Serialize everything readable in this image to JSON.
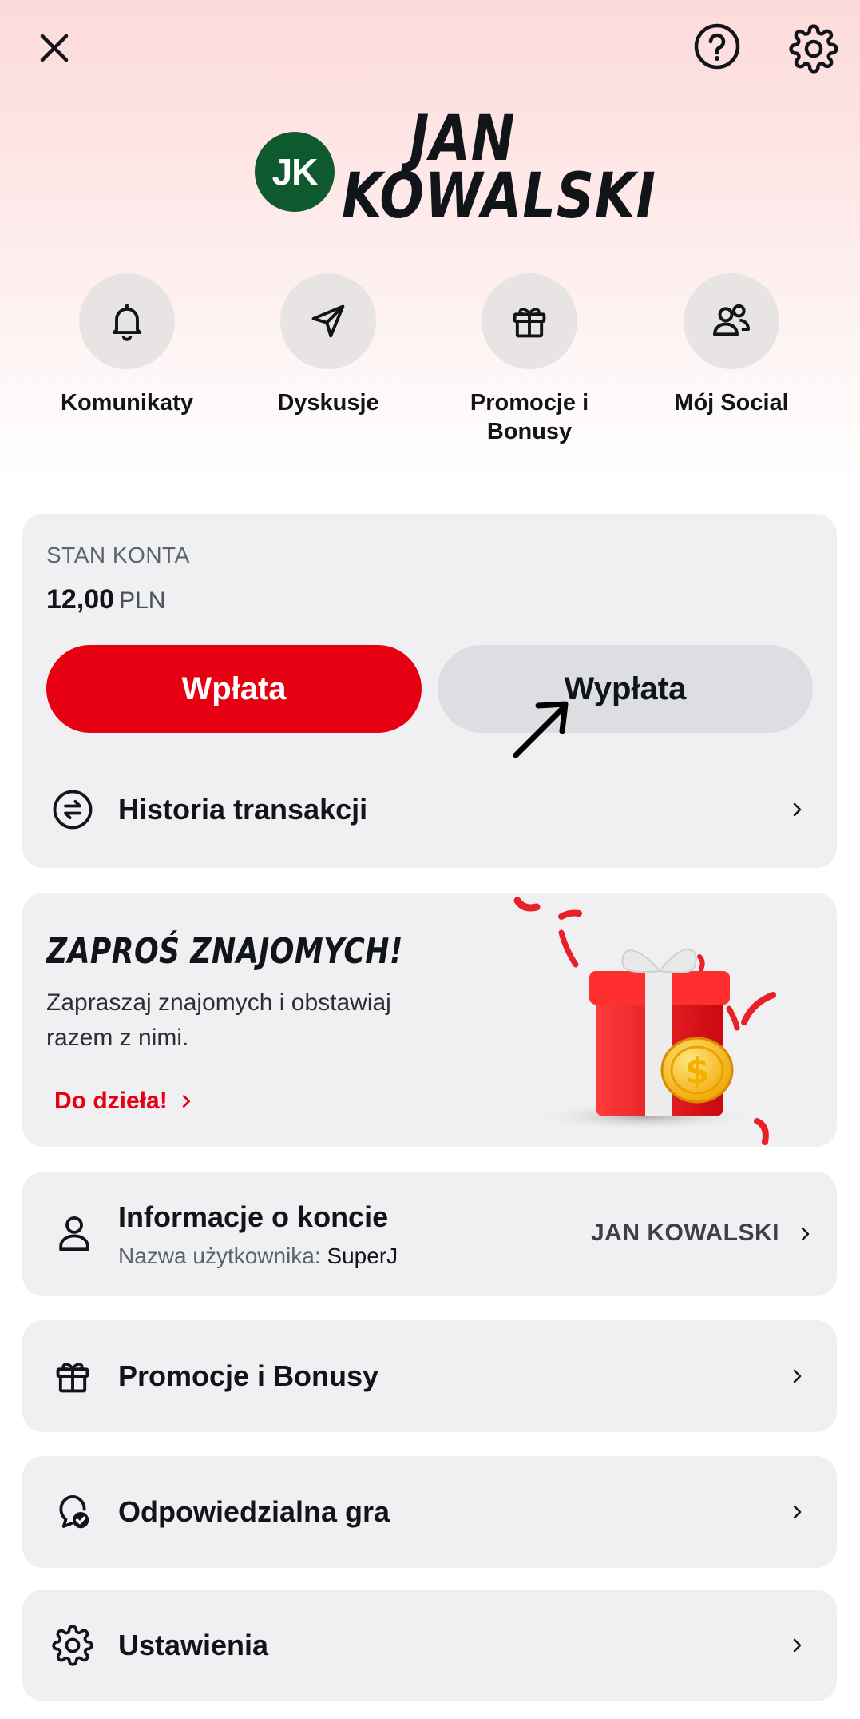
{
  "header": {
    "close_icon": "close-icon",
    "help_icon": "help-circle-icon",
    "settings_icon": "gear-icon"
  },
  "profile": {
    "initials": "JK",
    "name": "JAN KOWALSKI",
    "avatar_color": "#0e5a2e"
  },
  "quick_actions": [
    {
      "label": "Komunikaty",
      "icon": "bell-icon"
    },
    {
      "label": "Dyskusje",
      "icon": "send-icon"
    },
    {
      "label": "Promocje i Bonusy",
      "icon": "gift-icon"
    },
    {
      "label": "Mój Social",
      "icon": "users-icon"
    }
  ],
  "balance": {
    "label": "STAN KONTA",
    "amount": "12,00",
    "currency": "PLN",
    "deposit_label": "Wpłata",
    "withdraw_label": "Wypłata",
    "history_label": "Historia transakcji"
  },
  "invite": {
    "title": "ZAPROŚ ZNAJOMYCH!",
    "text": "Zapraszaj znajomych i obstawiaj razem z nimi.",
    "cta": "Do dzieła!"
  },
  "account": {
    "title": "Informacje o koncie",
    "sub_label": "Nazwa użytkownika:",
    "username": "SuperJ",
    "name": "JAN KOWALSKI"
  },
  "menu": [
    {
      "label": "Promocje i Bonusy",
      "icon": "gift-icon"
    },
    {
      "label": "Odpowiedzialna gra",
      "icon": "responsible-gaming-icon"
    },
    {
      "label": "Ustawienia",
      "icon": "gear-icon"
    }
  ],
  "colors": {
    "accent": "#e60012",
    "card_bg": "#f0f0f2",
    "secondary_button": "#dcdee2"
  }
}
